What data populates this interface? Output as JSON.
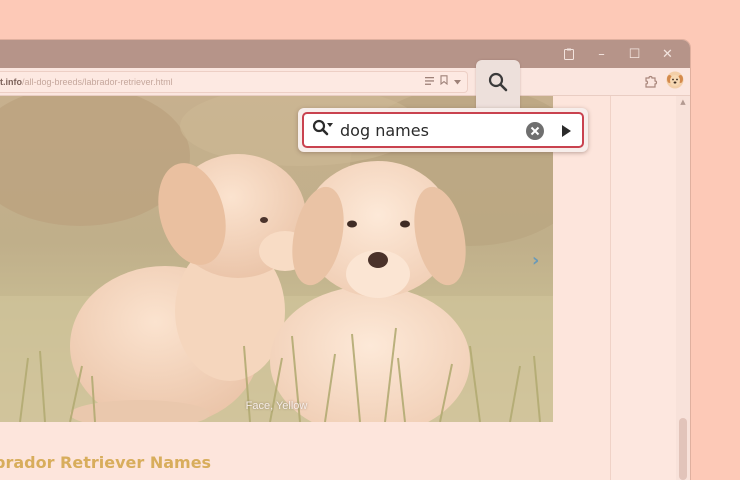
{
  "browser": {
    "url_domain": "t.info",
    "url_path": "/all-dog-breeds/labrador-retriever.html"
  },
  "window_controls": {
    "minimize": "–",
    "maximize": "☐",
    "close": "✕"
  },
  "find_bar": {
    "query": "dog names",
    "highlight_color": "#c9424f"
  },
  "page": {
    "image_caption": "Face, Yellow",
    "section_heading": "brador Retriever Names",
    "heading_color": "#d8ad5c",
    "carousel_next": "›"
  },
  "icons": {
    "find_tab": "magnifier-icon",
    "find_field": "search-options-icon",
    "clear": "clear-circle-icon",
    "next": "next-match-icon",
    "extensions": "puzzle-icon",
    "profile": "dog-avatar-icon",
    "reader": "reader-view-icon",
    "bookmark": "bookmark-icon",
    "dropdown": "chevron-down-icon",
    "clipboard": "clipboard-icon"
  }
}
